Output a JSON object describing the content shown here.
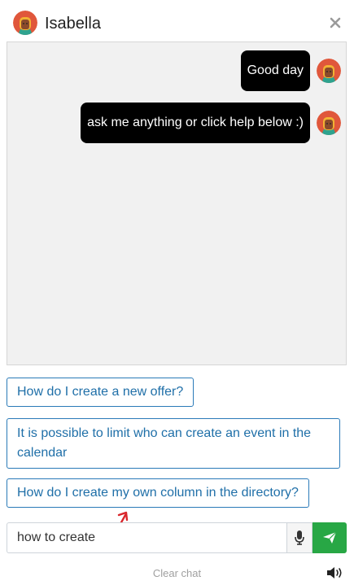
{
  "header": {
    "title": "Isabella",
    "avatar_icon": "avatar-icon",
    "close_icon": "close-icon"
  },
  "messages": [
    {
      "text": "Good day",
      "sender": "bot"
    },
    {
      "text": "ask me anything or click help below :)",
      "sender": "bot"
    }
  ],
  "suggestions": [
    "How do I create a new offer?",
    "It is possible to limit who can create an event in the calendar",
    "How do I create my own column in the directory?"
  ],
  "input": {
    "value": "how to create",
    "mic_icon": "microphone-icon",
    "send_icon": "send-icon"
  },
  "footer": {
    "clear_label": "Clear chat",
    "speaker_icon": "speaker-icon"
  },
  "colors": {
    "bubble_bg": "#000000",
    "conversation_bg": "#f1f1f1",
    "suggestion_border": "#2a7ab8",
    "suggestion_text": "#1f6fa8",
    "send_button": "#28a745",
    "annotation_arrow": "#d9262c"
  }
}
